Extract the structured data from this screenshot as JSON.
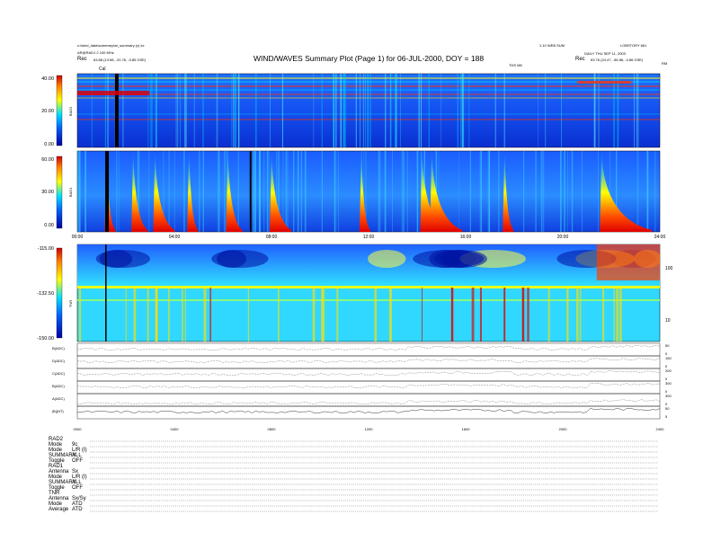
{
  "header": {
    "left_line1": "c:\\wind_data\\summary\\wi_summary (c) kx",
    "left_line2": "AR@RAD1 2 100 MHz",
    "left_rec_label": "Rec",
    "left_rec_value": "63.88 (13:58, -20.76, -0.85 GSE)",
    "title": "WIND/WAVES Summary Plot (Page 1) for 06-JUL-2000, DOY = 188",
    "right_line1": "1.10 WEB SUM",
    "right_line2": "DAILY THU SEP 11, 2003",
    "right_id": "LOBSTORY 661",
    "right_rec_label": "Rec",
    "right_rec_value": "63.76 (24.47, -56.88, -0.86 GSE)",
    "cal_label": "Cal",
    "tdsmk_label": "TDS MK",
    "rm_label": "RM"
  },
  "chart_data": [
    {
      "type": "heatmap",
      "name": "rad2",
      "ylabel": "RAD2",
      "yticks": [
        "40.00",
        "20.00",
        "0.00"
      ],
      "description_colors": [
        "#0000a0",
        "#0060ff",
        "#00e0ff",
        "#ffff00",
        "#ff8000",
        "#d00000"
      ]
    },
    {
      "type": "heatmap",
      "name": "rad1",
      "ylabel": "RAD1",
      "yticks": [
        "60.00",
        "30.00",
        "0.00"
      ],
      "bursts_hours": [
        1.2,
        2.3,
        3.2,
        4.6,
        6.2,
        8.0,
        11.7,
        14.2,
        14.6,
        17.6,
        21.6
      ],
      "xticks": [
        "00:00",
        "04:00",
        "08:00",
        "12:00",
        "16:00",
        "20:00",
        "24:00"
      ]
    },
    {
      "type": "heatmap",
      "name": "tnr",
      "ylabel": "TNR",
      "yticks": [
        "-115.00",
        "-132.50",
        "-150.00"
      ],
      "right_ticks": [
        "100",
        "10"
      ]
    },
    {
      "type": "line",
      "name": "aux",
      "series": [
        {
          "name": "B(ADC)",
          "right_ticks": [
            "50",
            "0"
          ]
        },
        {
          "name": "D(ADC)",
          "right_ticks": [
            "150",
            "0"
          ]
        },
        {
          "name": "C(ADC)",
          "right_ticks": [
            "200",
            "0"
          ]
        },
        {
          "name": "B(ADC)",
          "right_ticks": [
            "300",
            "0"
          ]
        },
        {
          "name": "A(ADC)",
          "right_ticks": [
            "300",
            "0"
          ]
        },
        {
          "name": "|B|(NT)",
          "right_ticks": [
            "50",
            "5"
          ]
        }
      ],
      "xticks": [
        "0000",
        "0400",
        "0800",
        "1200",
        "1600",
        "2000",
        "2400"
      ]
    }
  ],
  "records": {
    "group1": {
      "title": "RAD2",
      "rows": [
        [
          "Mode",
          "9c"
        ],
        [
          "Mode",
          "L/R (I)"
        ],
        [
          "SUMMARY",
          "ALL"
        ],
        [
          "Toggle",
          "OFF"
        ]
      ]
    },
    "group2": {
      "title": "RAD1",
      "rows": [
        [
          "Antenna",
          "Sx"
        ],
        [
          "Mode",
          "L/R (I)"
        ],
        [
          "SUMMARY",
          "ALL"
        ],
        [
          "Toggle",
          "OFF"
        ]
      ]
    },
    "group3": {
      "title": "TNR",
      "rows": [
        [
          "Antenna",
          "Sx/Sy"
        ],
        [
          "Mode",
          "ATD"
        ],
        [
          "Average",
          "ATD"
        ]
      ]
    }
  }
}
